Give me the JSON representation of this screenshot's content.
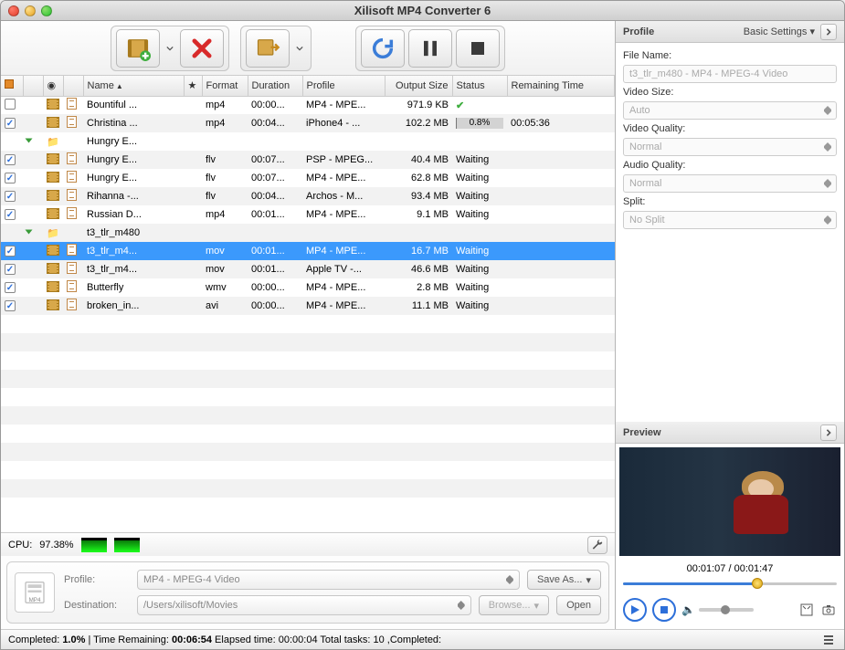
{
  "window": {
    "title": "Xilisoft MP4 Converter 6"
  },
  "toolbar": {
    "add": "Add File",
    "delete": "Delete",
    "convert_to": "Output Format",
    "convert": "Convert",
    "pause": "Pause",
    "stop": "Stop"
  },
  "columns": {
    "check": "",
    "clip": "",
    "name": "Name",
    "star": "★",
    "format": "Format",
    "duration": "Duration",
    "profile": "Profile",
    "output_size": "Output Size",
    "status": "Status",
    "remaining": "Remaining Time"
  },
  "rows": [
    {
      "expand": false,
      "checked": false,
      "type": "file",
      "name": "Bountiful ...",
      "format": "mp4",
      "duration": "00:00...",
      "profile": "MP4 - MPE...",
      "size": "971.9 KB",
      "status_kind": "done",
      "status_text": "",
      "remaining": ""
    },
    {
      "expand": false,
      "checked": true,
      "type": "file",
      "name": "Christina ...",
      "format": "mp4",
      "duration": "00:04...",
      "profile": "iPhone4 - ...",
      "size": "102.2 MB",
      "status_kind": "progress",
      "status_text": "0.8%",
      "progress": 1,
      "remaining": "00:05:36"
    },
    {
      "expand": true,
      "checked": null,
      "type": "folder",
      "name": "Hungry E...",
      "format": "",
      "duration": "",
      "profile": "",
      "size": "",
      "status_kind": "",
      "status_text": "",
      "remaining": ""
    },
    {
      "expand": false,
      "checked": true,
      "type": "file",
      "indent": 1,
      "name": "Hungry E...",
      "format": "flv",
      "duration": "00:07...",
      "profile": "PSP - MPEG...",
      "size": "40.4 MB",
      "status_kind": "text",
      "status_text": "Waiting",
      "remaining": ""
    },
    {
      "expand": false,
      "checked": true,
      "type": "file",
      "indent": 1,
      "name": "Hungry E...",
      "format": "flv",
      "duration": "00:07...",
      "profile": "MP4 - MPE...",
      "size": "62.8 MB",
      "status_kind": "text",
      "status_text": "Waiting",
      "remaining": ""
    },
    {
      "expand": false,
      "checked": true,
      "type": "file",
      "name": "Rihanna -...",
      "format": "flv",
      "duration": "00:04...",
      "profile": "Archos - M...",
      "size": "93.4 MB",
      "status_kind": "text",
      "status_text": "Waiting",
      "remaining": ""
    },
    {
      "expand": false,
      "checked": true,
      "type": "file",
      "name": "Russian D...",
      "format": "mp4",
      "duration": "00:01...",
      "profile": "MP4 - MPE...",
      "size": "9.1 MB",
      "status_kind": "text",
      "status_text": "Waiting",
      "remaining": ""
    },
    {
      "expand": true,
      "checked": null,
      "type": "folder",
      "name": "t3_tlr_m480",
      "format": "",
      "duration": "",
      "profile": "",
      "size": "",
      "status_kind": "",
      "status_text": "",
      "remaining": ""
    },
    {
      "expand": false,
      "checked": true,
      "type": "file",
      "indent": 1,
      "selected": true,
      "name": "t3_tlr_m4...",
      "format": "mov",
      "duration": "00:01...",
      "profile": "MP4 - MPE...",
      "size": "16.7 MB",
      "status_kind": "text",
      "status_text": "Waiting",
      "remaining": ""
    },
    {
      "expand": false,
      "checked": true,
      "type": "file",
      "indent": 1,
      "name": "t3_tlr_m4...",
      "format": "mov",
      "duration": "00:01...",
      "profile": "Apple TV -...",
      "size": "46.6 MB",
      "status_kind": "text",
      "status_text": "Waiting",
      "remaining": ""
    },
    {
      "expand": false,
      "checked": true,
      "type": "file",
      "name": "Butterfly",
      "format": "wmv",
      "duration": "00:00...",
      "profile": "MP4 - MPE...",
      "size": "2.8 MB",
      "status_kind": "text",
      "status_text": "Waiting",
      "remaining": ""
    },
    {
      "expand": false,
      "checked": true,
      "type": "file",
      "name": "broken_in...",
      "format": "avi",
      "duration": "00:00...",
      "profile": "MP4 - MPE...",
      "size": "11.1 MB",
      "status_kind": "text",
      "status_text": "Waiting",
      "remaining": ""
    }
  ],
  "cpu": {
    "label": "CPU:",
    "value": "97.38%"
  },
  "dest": {
    "profile_label": "Profile:",
    "profile_value": "MP4 - MPEG-4 Video",
    "save_as": "Save As...",
    "destination_label": "Destination:",
    "destination_value": "/Users/xilisoft/Movies",
    "browse": "Browse...",
    "open": "Open"
  },
  "status": {
    "text": "Completed: 1.0% | Time Remaining: 00:06:54 Elapsed time: 00:00:04 Total tasks: 10 ,Completed:"
  },
  "profile_panel": {
    "title": "Profile",
    "settings_label": "Basic Settings",
    "file_name_label": "File Name:",
    "file_name_value": "t3_tlr_m480 - MP4 - MPEG-4 Video",
    "video_size_label": "Video Size:",
    "video_size_value": "Auto",
    "video_quality_label": "Video Quality:",
    "video_quality_value": "Normal",
    "audio_quality_label": "Audio Quality:",
    "audio_quality_value": "Normal",
    "split_label": "Split:",
    "split_value": "No Split"
  },
  "preview": {
    "title": "Preview",
    "time_current": "00:01:07",
    "time_total": "00:01:47",
    "progress_pct": 63
  }
}
